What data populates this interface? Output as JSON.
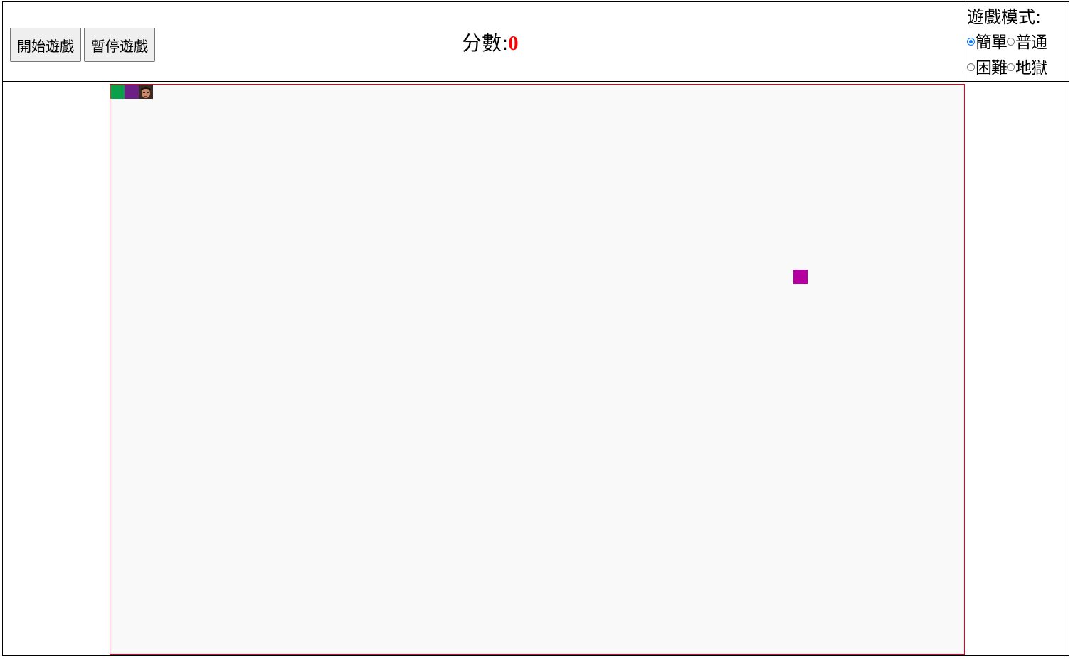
{
  "toolbar": {
    "start_label": "開始遊戲",
    "pause_label": "暫停遊戲"
  },
  "score": {
    "label": "分數:",
    "value": "0"
  },
  "mode": {
    "title": "遊戲模式:",
    "options": [
      {
        "label": "簡單",
        "selected": true
      },
      {
        "label": "普通",
        "selected": false
      },
      {
        "label": "困難",
        "selected": false
      },
      {
        "label": "地獄",
        "selected": false
      }
    ]
  },
  "board": {
    "colors": {
      "border": "#e0001a",
      "background": "#f9f9f9",
      "snake_tail": "#0aa04a",
      "snake_body": "#6e1f85",
      "food": "#b5009f",
      "score_value": "#ff0000"
    },
    "snake_head_icon": "face-avatar-icon"
  }
}
